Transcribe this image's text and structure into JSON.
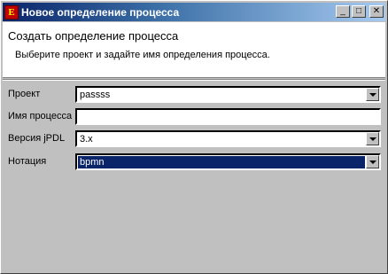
{
  "window": {
    "icon_glyph": "E",
    "title": "Новое определение процесса",
    "min_glyph": "_",
    "max_glyph": "□",
    "close_glyph": "✕"
  },
  "banner": {
    "title": "Создать определение процесса",
    "description": "Выберите проект и задайте имя определения процесса."
  },
  "form": {
    "project": {
      "label": "Проект",
      "value": "passss"
    },
    "process_name": {
      "label": "Имя процесса",
      "value": ""
    },
    "jpdl_version": {
      "label": "Версия jPDL",
      "value": "3.x"
    },
    "notation": {
      "label": "Нотация",
      "value": "bpmn"
    }
  },
  "colors": {
    "title_bar_start": "#0a246a",
    "selection": "#0a246a",
    "window_bg": "#c0c0c0"
  },
  "icons": [
    "app-icon",
    "minimize-icon",
    "maximize-icon",
    "close-icon",
    "dropdown-arrow-icon"
  ]
}
